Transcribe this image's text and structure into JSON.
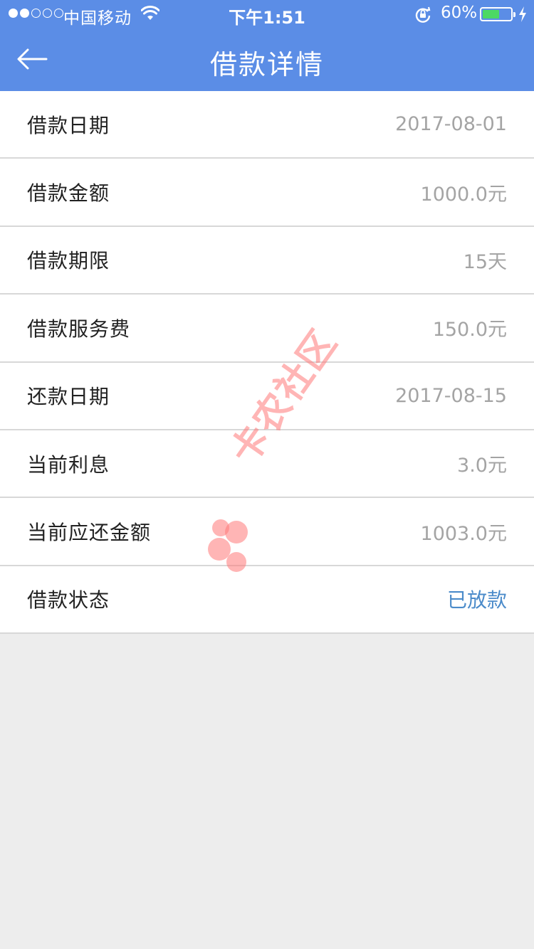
{
  "status_bar": {
    "carrier": "中国移动",
    "time": "下午1:51",
    "battery_percent": "60%",
    "battery_level": 0.6,
    "signal_bars": 2,
    "signal_total": 5
  },
  "header": {
    "title": "借款详情",
    "back_icon": "arrow-left-icon"
  },
  "details": [
    {
      "label": "借款日期",
      "value": "2017-08-01"
    },
    {
      "label": "借款金额",
      "value": "1000.0元"
    },
    {
      "label": "借款期限",
      "value": "15天"
    },
    {
      "label": "借款服务费",
      "value": "150.0元"
    },
    {
      "label": "还款日期",
      "value": "2017-08-15"
    },
    {
      "label": "当前利息",
      "value": "3.0元"
    },
    {
      "label": "当前应还金额",
      "value": "1003.0元"
    },
    {
      "label": "借款状态",
      "value": "已放款"
    }
  ],
  "watermark": {
    "text": "卡农社区"
  },
  "colors": {
    "header": "#5b8de6",
    "status_value": "#4b8bca",
    "value_gray": "#a4a4a4",
    "background": "#ededed"
  }
}
